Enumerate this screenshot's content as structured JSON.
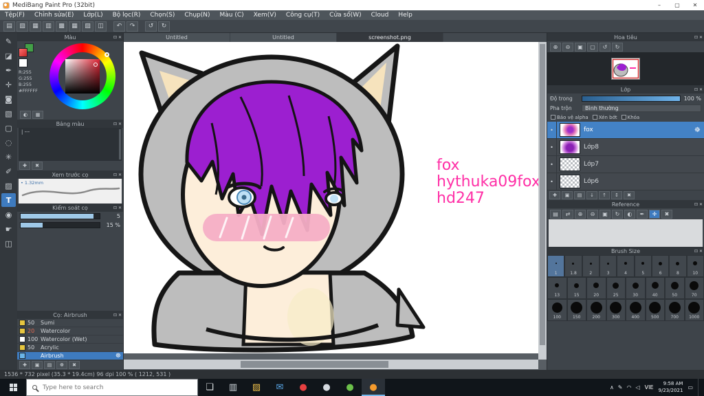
{
  "window": {
    "title": "MediBang Paint Pro (32bit)",
    "minimize": "–",
    "maximize": "▢",
    "close": "✕"
  },
  "panel_icons": {
    "detach": "⊡",
    "close": "✕",
    "gear": "☸",
    "eye": "•"
  },
  "menu": [
    "Tệp(F)",
    "Chỉnh sửa(E)",
    "Lớp(L)",
    "Bộ lọc(R)",
    "Chọn(S)",
    "Chụp(N)",
    "Màu (C)",
    "Xem(V)",
    "Công cụ(T)",
    "Cửa sổ(W)",
    "Cloud",
    "Help"
  ],
  "toolbar": [
    {
      "name": "new-canvas-icon",
      "glyph": "▤"
    },
    {
      "name": "open-file-icon",
      "glyph": "▧"
    },
    {
      "name": "save-file-icon",
      "glyph": "▦"
    },
    {
      "name": "export-image-icon",
      "glyph": "▥"
    },
    {
      "name": "canvas-size-icon",
      "glyph": "▩"
    },
    {
      "name": "grid-toggle-icon",
      "glyph": "▦"
    },
    {
      "name": "material-panel-icon",
      "glyph": "▨"
    },
    {
      "name": "snap-settings-icon",
      "glyph": "◫"
    },
    {
      "name": "divider",
      "glyph": ""
    },
    {
      "name": "undo-icon",
      "glyph": "↶"
    },
    {
      "name": "redo-icon",
      "glyph": "↷"
    },
    {
      "name": "divider",
      "glyph": ""
    },
    {
      "name": "rotate-left-icon",
      "glyph": "↺"
    },
    {
      "name": "rotate-right-icon",
      "glyph": "↻"
    }
  ],
  "tool_strip": [
    {
      "name": "pen-tool",
      "glyph": "✎"
    },
    {
      "name": "eraser-tool",
      "glyph": "◪"
    },
    {
      "name": "brush-tool",
      "glyph": "✒"
    },
    {
      "name": "move-tool",
      "glyph": "✛"
    },
    {
      "name": "fill-tool",
      "glyph": "◙"
    },
    {
      "name": "gradient-tool",
      "glyph": "▧"
    },
    {
      "name": "select-tool",
      "glyph": "▢"
    },
    {
      "name": "lasso-tool",
      "glyph": "◌"
    },
    {
      "name": "magic-wand-tool",
      "glyph": "✳"
    },
    {
      "name": "select-pen-tool",
      "glyph": "✐"
    },
    {
      "name": "select-eraser-tool",
      "glyph": "▨"
    },
    {
      "name": "text-tool",
      "glyph": "T",
      "active": true
    },
    {
      "name": "eyedropper-tool",
      "glyph": "◉"
    },
    {
      "name": "hand-tool",
      "glyph": "☛"
    },
    {
      "name": "divide-tool",
      "glyph": "◫"
    }
  ],
  "left_panels": {
    "color": {
      "title": "Màu",
      "rgb_r": "R:255",
      "rgb_g": "G:255",
      "rgb_b": "B:255",
      "hex": "#FFFFFF",
      "buttons": [
        {
          "name": "screen-picker-icon",
          "glyph": "◐"
        },
        {
          "name": "palette-mode-icon",
          "glyph": "▦"
        }
      ]
    },
    "palette": {
      "title": "Bảng màu",
      "entry": "| ---",
      "buttons": [
        {
          "name": "add-color-icon",
          "glyph": "✚"
        },
        {
          "name": "delete-color-icon",
          "glyph": "✖"
        }
      ]
    },
    "preview": {
      "title": "Xem trước cọ",
      "size_label": "• 1.32mm"
    },
    "control": {
      "title": "Kiểm soát cọ",
      "size_value": "5",
      "opacity_value": "15 %"
    },
    "brushes": {
      "title": "Cọ: Airbrush",
      "items": [
        {
          "size": "50",
          "name": "Sumi",
          "chip": "#e7c63f"
        },
        {
          "size": "20",
          "name": "Watercolor",
          "chip": "#e7c63f",
          "size_color": "#e06a50"
        },
        {
          "size": "100",
          "name": "Watercolor (Wet)",
          "chip": "#ffffff"
        },
        {
          "size": "50",
          "name": "Acrylic",
          "chip": "#e7c63f"
        },
        {
          "size": "",
          "name": "Airbrush",
          "chip": "#6ab4e8",
          "selected": true
        }
      ],
      "buttons": [
        {
          "name": "add-brush-icon",
          "glyph": "✚"
        },
        {
          "name": "add-brush-folder-icon",
          "glyph": "▣"
        },
        {
          "name": "duplicate-brush-icon",
          "glyph": "▤"
        },
        {
          "name": "brush-settings-icon",
          "glyph": "☸"
        },
        {
          "name": "delete-brush-icon",
          "glyph": "✖"
        }
      ]
    }
  },
  "canvas": {
    "tabs": [
      {
        "label": "Untitled"
      },
      {
        "label": "Untitled"
      },
      {
        "label": "screenshot.png",
        "active": true
      }
    ],
    "signature": [
      "fox",
      "hythuka09fox",
      "hd247"
    ],
    "signature_color": "#ff2fa6"
  },
  "right_panels": {
    "navigator": {
      "title": "Hoa tiêu",
      "buttons": [
        {
          "name": "zoom-in-icon",
          "glyph": "⊕"
        },
        {
          "name": "zoom-out-icon",
          "glyph": "⊖"
        },
        {
          "name": "zoom-fit-icon",
          "glyph": "▣"
        },
        {
          "name": "zoom-100-icon",
          "glyph": "▢"
        },
        {
          "name": "rotate-left-icon",
          "glyph": "↺"
        },
        {
          "name": "rotate-right-icon",
          "glyph": "↻"
        }
      ]
    },
    "layers": {
      "title": "Lớp",
      "opacity_label": "Độ trong",
      "opacity_value": "100 %",
      "blend_label": "Pha trộn",
      "blend_value": "Bình thường",
      "checkboxes": [
        "Bảo vệ alpha",
        "Xén bớt",
        "Khóa"
      ],
      "items": [
        {
          "name": "fox",
          "thumb": "art",
          "selected": true
        },
        {
          "name": "Lớp8",
          "thumb": "purple"
        },
        {
          "name": "Lớp7",
          "thumb": "checker"
        },
        {
          "name": "Lớp6",
          "thumb": "checker"
        }
      ],
      "buttons": [
        {
          "name": "add-layer-icon",
          "glyph": "✚"
        },
        {
          "name": "add-folder-icon",
          "glyph": "▣"
        },
        {
          "name": "duplicate-layer-icon",
          "glyph": "▤"
        },
        {
          "name": "merge-down-icon",
          "glyph": "↓"
        },
        {
          "name": "move-up-icon",
          "glyph": "↑"
        },
        {
          "name": "move-down-icon",
          "glyph": "↕"
        },
        {
          "name": "delete-layer-icon",
          "glyph": "✖"
        }
      ]
    },
    "reference": {
      "title": "Reference",
      "buttons": [
        {
          "name": "open-image-icon",
          "glyph": "▤"
        },
        {
          "name": "flip-icon",
          "glyph": "⇄"
        },
        {
          "name": "zoom-in-icon",
          "glyph": "⊕"
        },
        {
          "name": "zoom-out-icon",
          "glyph": "⊖"
        },
        {
          "name": "fit-icon",
          "glyph": "▣"
        },
        {
          "name": "rotate-icon",
          "glyph": "↻"
        },
        {
          "name": "grayscale-icon",
          "glyph": "◐"
        },
        {
          "name": "eyedropper-icon",
          "glyph": "✒"
        },
        {
          "name": "hand-icon",
          "glyph": "✛",
          "active": true
        },
        {
          "name": "clear-icon",
          "glyph": "✖"
        }
      ]
    },
    "brush_size": {
      "title": "Brush Size",
      "selected": "1",
      "rows": [
        [
          "1",
          "1.8",
          "2",
          "3",
          "4",
          "5",
          "6",
          "8",
          "10"
        ],
        [
          "13",
          "15",
          "20",
          "25",
          "30",
          "40",
          "50",
          "70"
        ],
        [
          "100",
          "150",
          "200",
          "300",
          "400",
          "500",
          "700",
          "1000"
        ]
      ]
    }
  },
  "status_bar": "1536 * 732 pixel   (35.3 * 19.4cm)   96 dpi   100 %   ( 1212, 531 )",
  "taskbar": {
    "search_placeholder": "Type here to search",
    "apps": [
      {
        "name": "task-view-icon",
        "glyph": "❏",
        "color": "#dfe3e6"
      },
      {
        "name": "store-icon",
        "glyph": "▥",
        "color": "#cfd6dc"
      },
      {
        "name": "file-explorer-icon",
        "glyph": "▨",
        "color": "#f0c14b"
      },
      {
        "name": "mail-icon",
        "glyph": "✉",
        "color": "#59a7e8"
      },
      {
        "name": "opera-icon",
        "glyph": "●",
        "color": "#e84040"
      },
      {
        "name": "steam-icon",
        "glyph": "●",
        "color": "#d5dae0"
      },
      {
        "name": "chrome-icon",
        "glyph": "●",
        "color": "#6cc04a"
      },
      {
        "name": "medibang-icon",
        "glyph": "●",
        "color": "#f59b2d",
        "active": true
      }
    ],
    "tray_icons": [
      {
        "name": "chevron-up-icon",
        "glyph": "∧"
      },
      {
        "name": "pen-input-icon",
        "glyph": "✎"
      },
      {
        "name": "network-icon",
        "glyph": "◠"
      },
      {
        "name": "volume-icon",
        "glyph": "◁"
      }
    ],
    "lang": "VIE",
    "time": "9:58 AM",
    "date": "9/23/2021",
    "notification_glyph": "▭"
  }
}
